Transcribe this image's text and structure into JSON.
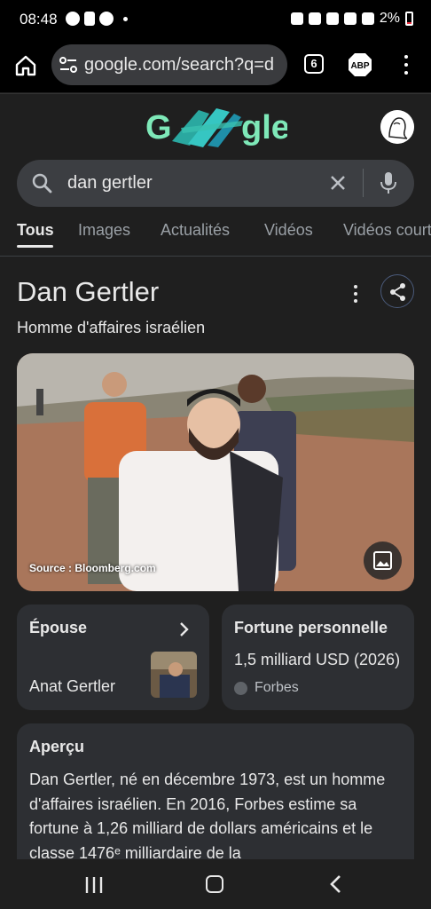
{
  "status_bar": {
    "time": "08:48",
    "battery": "2%"
  },
  "browser": {
    "url": "google.com/search?q=d",
    "tab_count": "6",
    "abp_label": "ABP"
  },
  "search": {
    "query": "dan gertler"
  },
  "tabs": [
    {
      "label": "Tous",
      "active": true
    },
    {
      "label": "Images"
    },
    {
      "label": "Actualités"
    },
    {
      "label": "Vidéos"
    },
    {
      "label": "Vidéos courtes"
    }
  ],
  "knowledge_panel": {
    "title": "Dan Gertler",
    "subtitle": "Homme d'affaires israélien",
    "photo_source": "Source : Bloomberg.com",
    "spouse_card": {
      "title": "Épouse",
      "name": "Anat Gertler"
    },
    "fortune_card": {
      "title": "Fortune personnelle",
      "value": "1,5 milliard USD (2026)",
      "source": "Forbes"
    },
    "overview": {
      "title": "Aperçu",
      "text": "Dan Gertler, né en décembre 1973, est un homme d'affaires israélien. En 2016, Forbes estime sa fortune à 1,26 milliard de dollars américains et le classe 1476ᵉ milliardaire de la"
    }
  },
  "colors": {
    "background": "#1f1f1f",
    "card": "#2d2f33",
    "search_box": "#3c3e42"
  }
}
